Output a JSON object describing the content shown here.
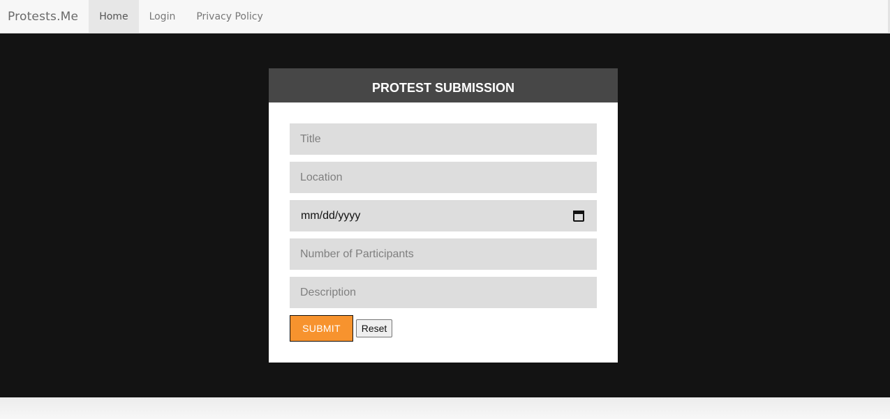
{
  "navbar": {
    "brand": "Protests.Me",
    "items": [
      {
        "label": "Home",
        "active": true
      },
      {
        "label": "Login",
        "active": false
      },
      {
        "label": "Privacy Policy",
        "active": false
      }
    ]
  },
  "form": {
    "title": "PROTEST SUBMISSION",
    "fields": {
      "title_placeholder": "Title",
      "location_placeholder": "Location",
      "date_placeholder": "mm/dd/yyyy",
      "participants_placeholder": "Number of Participants",
      "description_placeholder": "Description"
    },
    "submit_label": "SUBMIT",
    "reset_label": "Reset"
  },
  "icons": {
    "date_picker": "calendar-icon"
  },
  "colors": {
    "hero_background": "#131313",
    "card_header": "#474747",
    "submit_button": "#f7932e",
    "field_background": "#dddddd"
  }
}
